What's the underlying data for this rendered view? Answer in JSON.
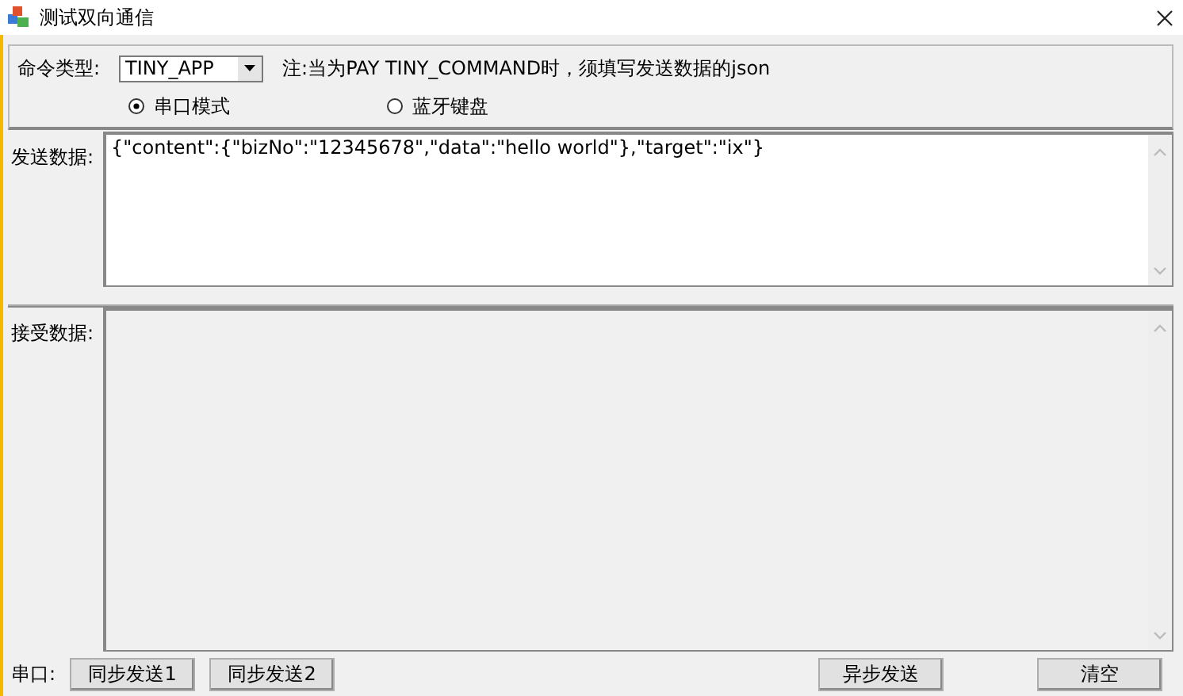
{
  "window": {
    "title": "测试双向通信"
  },
  "command": {
    "label": "命令类型:",
    "value": "TINY_APP",
    "note": "注:当为PAY TINY_COMMAND时，须填写发送数据的json"
  },
  "modes": [
    {
      "label": "串口模式",
      "selected": true
    },
    {
      "label": "蓝牙键盘",
      "selected": false
    }
  ],
  "send": {
    "label": "发送数据:",
    "value": "{\"content\":{\"bizNo\":\"12345678\",\"data\":\"hello world\"},\"target\":\"ix\"}"
  },
  "receive": {
    "label": "接受数据:"
  },
  "footer": {
    "label": "串口:",
    "buttons": [
      {
        "label": "同步发送1"
      },
      {
        "label": "同步发送2"
      },
      {
        "label": "异步发送"
      },
      {
        "label": "清空"
      }
    ]
  }
}
